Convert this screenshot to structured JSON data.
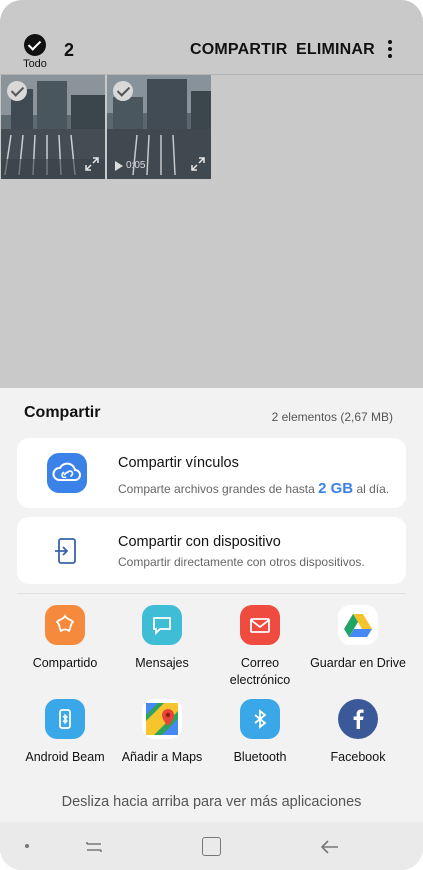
{
  "topbar": {
    "select_all_label": "Todo",
    "selected_count": "2",
    "share_label": "COMPARTIR",
    "delete_label": "ELIMINAR",
    "more_icon": "more-vert-icon"
  },
  "thumbnails": [
    {
      "type": "image",
      "selected": true
    },
    {
      "type": "video",
      "selected": true,
      "duration": "0:05"
    }
  ],
  "sheet": {
    "title": "Compartir",
    "meta": "2 elementos (2,67 MB)",
    "links": {
      "title": "Compartir vínculos",
      "sub_prefix": "Comparte archivos grandes de hasta ",
      "sub_highlight": "2 GB",
      "sub_suffix": " al día.",
      "icon": "cloud-link-icon",
      "accent": "#3b82e8"
    },
    "device": {
      "title": "Compartir con dispositivo",
      "sub": "Compartir directamente con otros dispositivos.",
      "icon": "share-to-device-icon"
    },
    "apps": [
      {
        "label": "Compartido",
        "icon": "shared-album-icon",
        "color": "#f58a3c"
      },
      {
        "label": "Mensajes",
        "icon": "messages-icon",
        "color": "#3fbcd6"
      },
      {
        "label": "Correo electrónico",
        "icon": "email-icon",
        "color": "#ef4b3e"
      },
      {
        "label": "Guardar en Drive",
        "icon": "google-drive-icon",
        "color": "#ffffff"
      },
      {
        "label": "Android Beam",
        "icon": "android-beam-icon",
        "color": "#3aa7e8"
      },
      {
        "label": "Añadir a Maps",
        "icon": "google-maps-icon",
        "color": "#ffffff"
      },
      {
        "label": "Bluetooth",
        "icon": "bluetooth-icon",
        "color": "#3aa7e8"
      },
      {
        "label": "Facebook",
        "icon": "facebook-icon",
        "color": "#3b5998"
      }
    ],
    "hint": "Desliza hacia arriba para ver más aplicaciones"
  },
  "navbar": {
    "recent_icon": "recent-apps-icon",
    "home_icon": "home-icon",
    "back_icon": "back-icon"
  }
}
